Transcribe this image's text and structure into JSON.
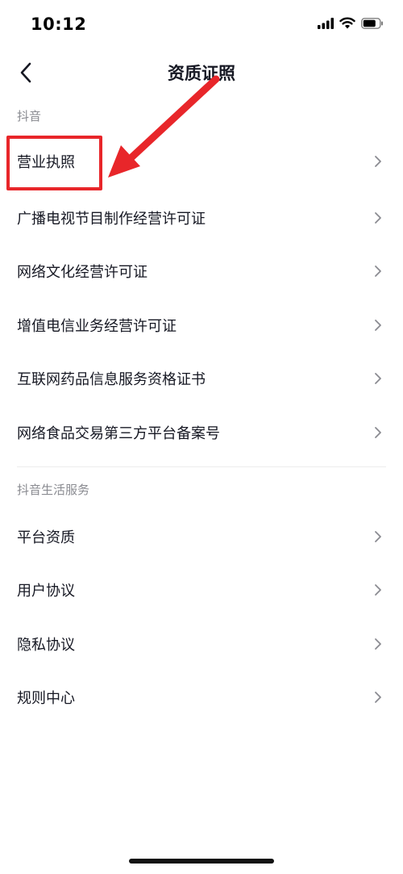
{
  "status_bar": {
    "time": "10:12",
    "icons": [
      "signal-icon",
      "wifi-icon",
      "battery-icon"
    ]
  },
  "nav": {
    "title": "资质证照",
    "back_icon": "back-arrow-icon"
  },
  "sections": [
    {
      "header": "抖音",
      "items": [
        {
          "label": "营业执照"
        },
        {
          "label": "广播电视节目制作经营许可证"
        },
        {
          "label": "网络文化经营许可证"
        },
        {
          "label": "增值电信业务经营许可证"
        },
        {
          "label": "互联网药品信息服务资格证书"
        },
        {
          "label": "网络食品交易第三方平台备案号"
        }
      ]
    },
    {
      "header": "抖音生活服务",
      "items": [
        {
          "label": "平台资质"
        },
        {
          "label": "用户协议"
        },
        {
          "label": "隐私协议"
        },
        {
          "label": "规则中心"
        }
      ]
    }
  ],
  "annotation": {
    "color": "#e8262a",
    "highlighted_item": "营业执照"
  },
  "colors": {
    "text_primary": "#161823",
    "text_secondary": "#8a8b91",
    "divider": "#ececec"
  }
}
